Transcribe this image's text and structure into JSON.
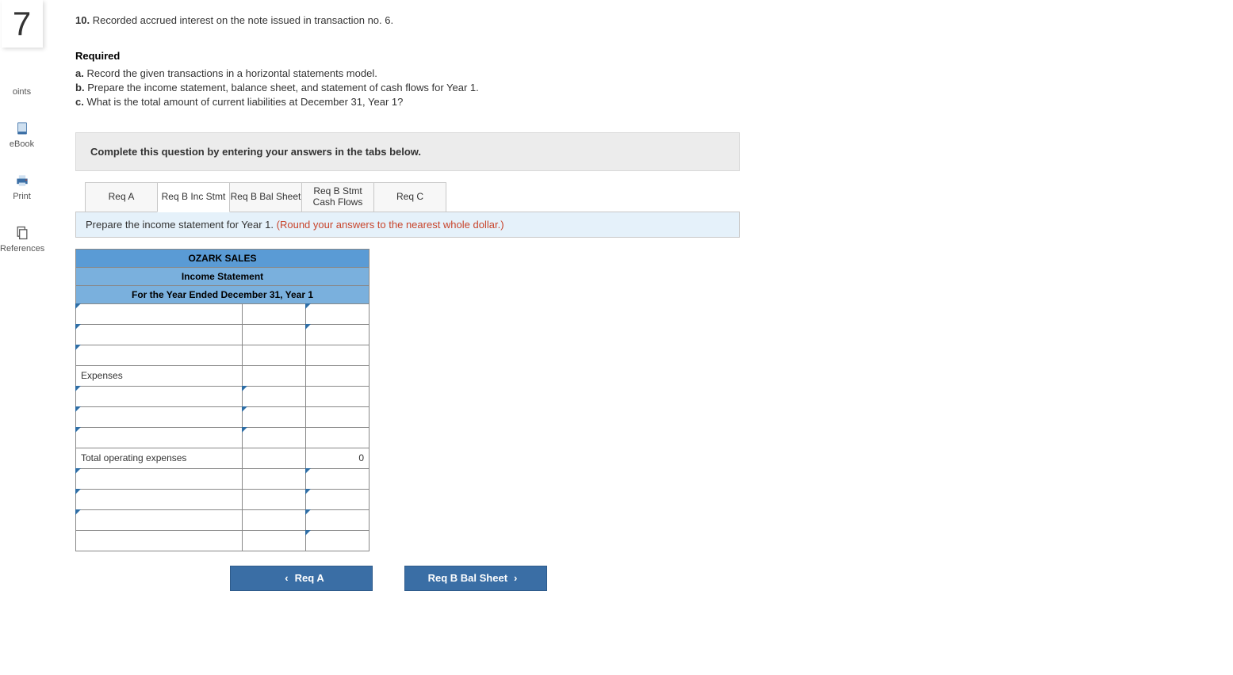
{
  "question_number": "7",
  "intro": {
    "num": "10.",
    "text": "Recorded accrued interest on the note issued in transaction no. 6."
  },
  "required": {
    "heading": "Required",
    "items": [
      {
        "letter": "a.",
        "text": "Record the given transactions in a horizontal statements model."
      },
      {
        "letter": "b.",
        "text": "Prepare the income statement, balance sheet, and statement of cash flows for Year 1."
      },
      {
        "letter": "c.",
        "text": "What is the total amount of current liabilities at December 31, Year 1?"
      }
    ]
  },
  "sidebar": {
    "points": "oints",
    "ebook": "eBook",
    "print": "Print",
    "refs": "References"
  },
  "instruction_box": "Complete this question by entering your answers in the tabs below.",
  "tabs": [
    {
      "label": "Req A"
    },
    {
      "label": "Req B Inc Stmt"
    },
    {
      "label": "Req B Bal Sheet"
    },
    {
      "label": "Req B Stmt Cash Flows"
    },
    {
      "label": "Req C"
    }
  ],
  "panel_note": {
    "main": "Prepare the income statement for Year 1. ",
    "red": "(Round your answers to the nearest whole dollar.)"
  },
  "table": {
    "company": "OZARK SALES",
    "title": "Income Statement",
    "period": "For the Year Ended December 31, Year 1",
    "expenses_label": "Expenses",
    "total_op_label": "Total operating expenses",
    "total_op_value": "0"
  },
  "nav": {
    "prev": "Req A",
    "next": "Req B Bal Sheet"
  }
}
